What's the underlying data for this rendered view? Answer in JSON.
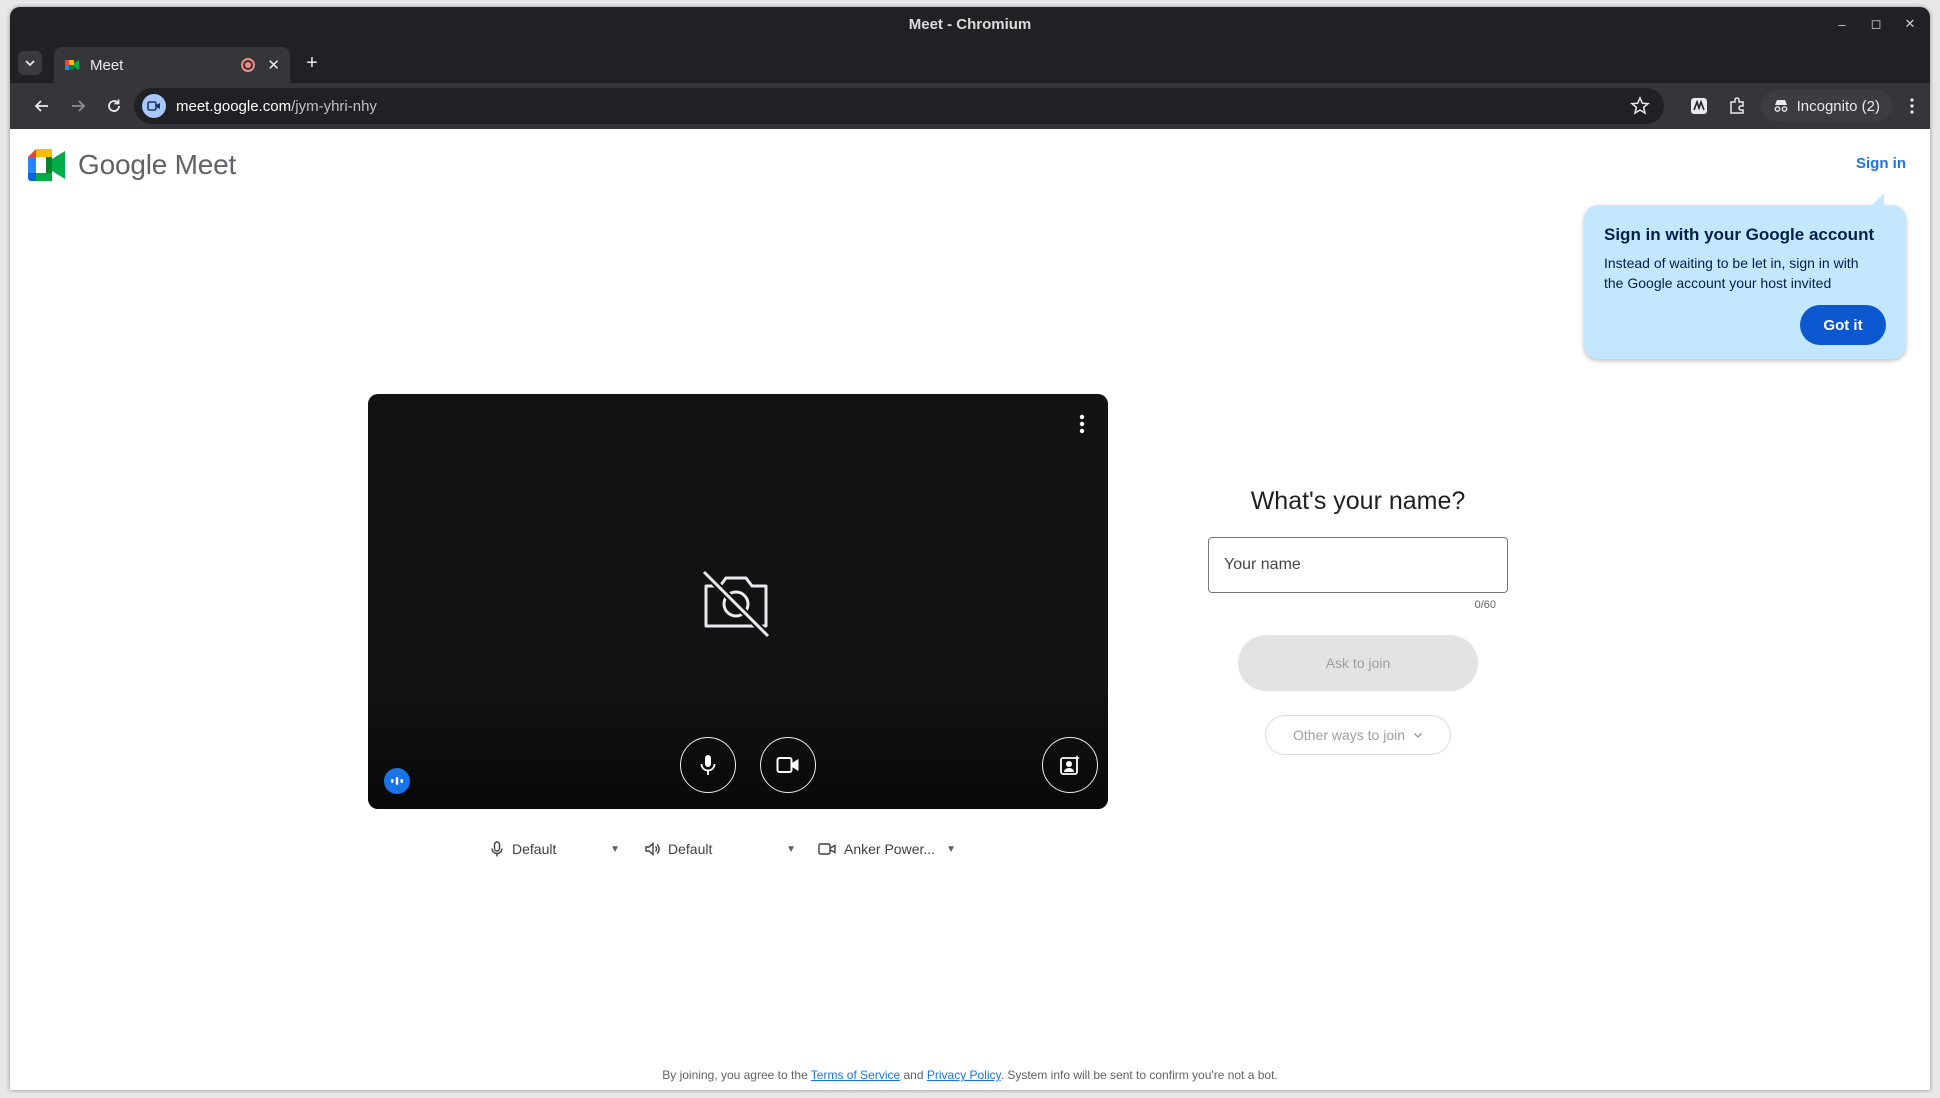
{
  "window": {
    "title": "Meet - Chromium"
  },
  "tab": {
    "title": "Meet"
  },
  "address": {
    "host": "meet.google.com",
    "path": "/jym-yhri-nhy"
  },
  "toolbar": {
    "incognito_label": "Incognito (2)"
  },
  "header": {
    "logo_text": "Google Meet",
    "signin_label": "Sign in"
  },
  "callout": {
    "title": "Sign in with your Google account",
    "body": "Instead of waiting to be let in, sign in with the Google account your host invited",
    "button": "Got it"
  },
  "join": {
    "title": "What's your name?",
    "name_placeholder": "Your name",
    "counter": "0/60",
    "ask_label": "Ask to join",
    "other_ways_label": "Other ways to join"
  },
  "devices": {
    "microphone": "Default",
    "speaker": "Default",
    "camera": "Anker Power..."
  },
  "footer": {
    "prefix": "By joining, you agree to the ",
    "terms": "Terms of Service",
    "and": " and ",
    "privacy": "Privacy Policy",
    "suffix": ". System info will be sent to confirm you're not a bot."
  },
  "colors": {
    "accent": "#1a73e8",
    "callout_bg": "#c2e7ff",
    "callout_button": "#0b57d0",
    "video_bg": "#121212"
  }
}
